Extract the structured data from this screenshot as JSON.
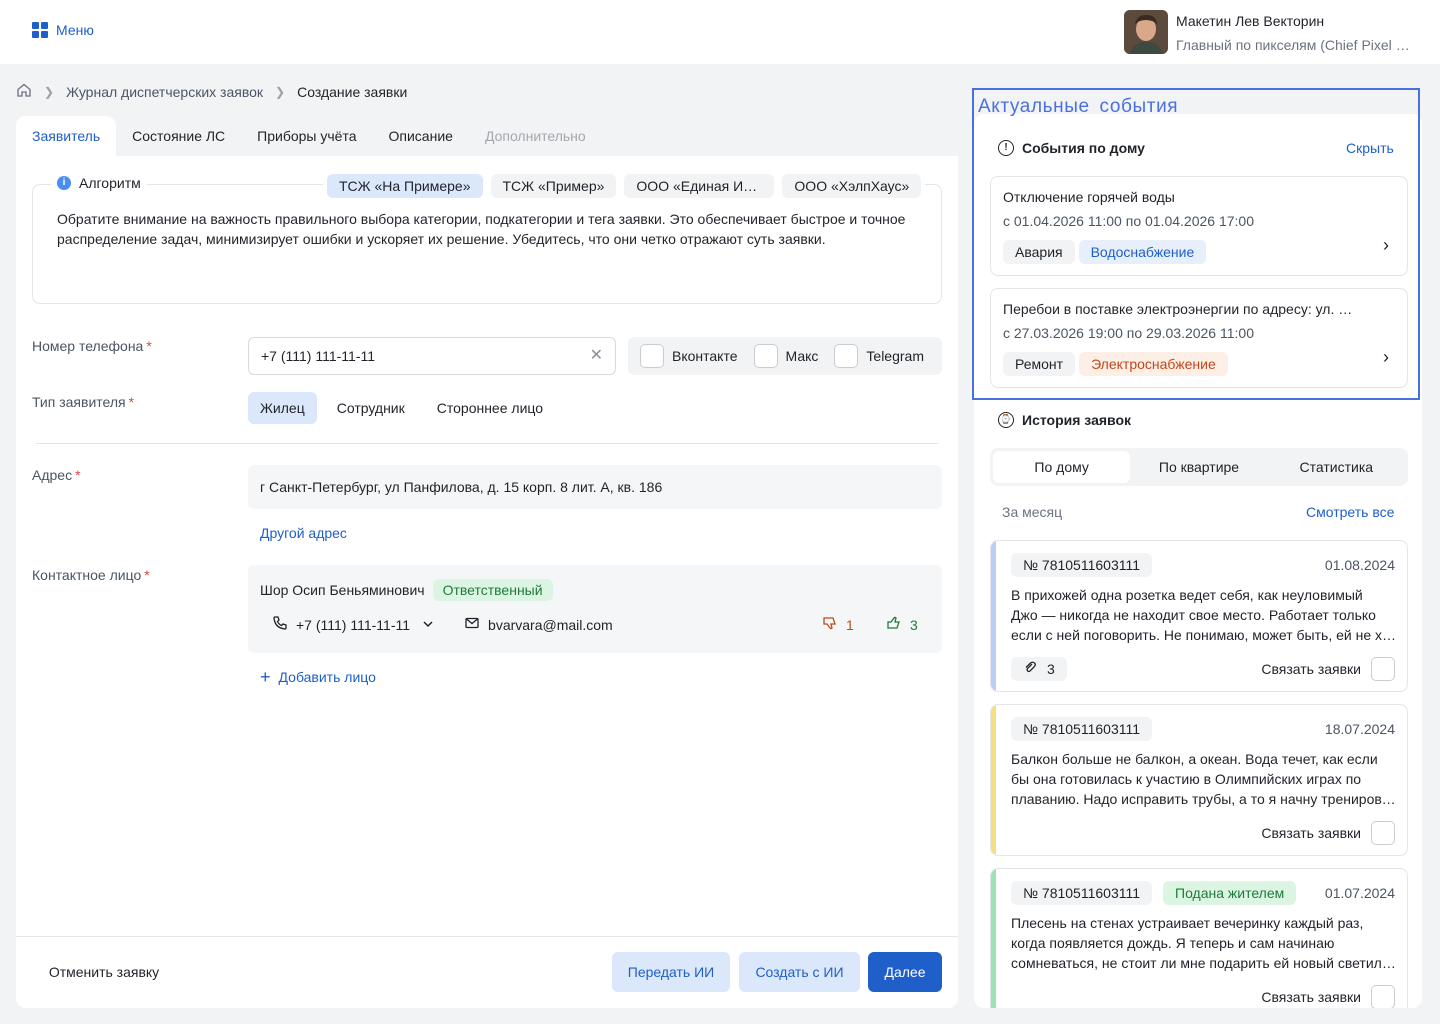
{
  "topbar": {
    "menu_label": "Меню",
    "user_name": "Макетин Лев Векторин",
    "user_role": "Главный по пикселям (Chief Pixel Officer)"
  },
  "breadcrumb": [
    "Журнал диспетчерских заявок",
    "Создание заявки"
  ],
  "tabs": [
    {
      "label": "Заявитель",
      "state": "active"
    },
    {
      "label": "Состояние ЛС",
      "state": "normal"
    },
    {
      "label": "Приборы учёта",
      "state": "normal"
    },
    {
      "label": "Описание",
      "state": "normal"
    },
    {
      "label": "Дополнительно",
      "state": "disabled"
    }
  ],
  "algorithm": {
    "title": "Алгоритм",
    "orgs": [
      "ТСЖ «На Примере»",
      "ТСЖ «Пример»",
      "ООО «Единая Информационная Служба»",
      "ООО «ХэлпХаус»"
    ],
    "selected_org": "ТСЖ «На Примере»",
    "text": "Обратите внимание на важность правильного выбора категории, подкатегории и тега заявки. Это обеспечивает быстрое и точное распределение задач, минимизирует ошибки и ускоряет их решение. Убедитесь, что они четко отражают суть заявки."
  },
  "form": {
    "phone_label": "Номер телефона",
    "phone_value": "+7 (111) 111-11-11",
    "messengers": [
      "Вконтакте",
      "Макс",
      "Telegram"
    ],
    "applicant_type_label": "Тип заявителя",
    "applicant_types": [
      "Жилец",
      "Сотрудник",
      "Стороннее лицо"
    ],
    "applicant_type_selected": "Жилец",
    "address_label": "Адрес",
    "address_value": "г Санкт-Петербург, ул Панфилова, д. 15 корп. 8 лит. А, кв. 186",
    "other_address": "Другой адрес",
    "contact_label": "Контактное лицо",
    "contact": {
      "name": "Шор Осип Беньяминович",
      "badge": "Ответственный",
      "phone": "+7 (111) 111-11-11",
      "email": "bvarvara@mail.com",
      "dislikes": "1",
      "likes": "3"
    },
    "add_contact": "Добавить лицо"
  },
  "footer": {
    "cancel": "Отменить заявку",
    "send_ai": "Передать ИИ",
    "create_ai": "Создать с ИИ",
    "next": "Далее"
  },
  "side": {
    "events_title": "Актуальные события",
    "house_events_title": "События по дому",
    "hide": "Скрыть",
    "events": [
      {
        "title": "Отключение горячей воды",
        "date": "с 01.04.2026 11:00 по 01.04.2026 17:00",
        "tags": [
          "Авария",
          "Водоснабжение"
        ]
      },
      {
        "title": "Перебои в поставке электроэнергии по адресу: ул. Панфилова",
        "date": "с 27.03.2026 19:00 по 29.03.2026 11:00",
        "tags": [
          "Ремонт",
          "Электроснабжение"
        ]
      }
    ],
    "history_title": "История заявок",
    "history_tabs": [
      "По дому",
      "По квартире",
      "Статистика"
    ],
    "history_tab_selected": "По дому",
    "period": "За месяц",
    "see_all": "Смотреть все",
    "link_label": "Связать заявки",
    "history": [
      {
        "number": "№ 7810511603111",
        "date": "01.08.2024",
        "stripe": "#b8cff5",
        "badge": "",
        "attachments": "3",
        "lines": [
          "В прихожей одна розетка ведет себя, как неуловимый",
          "Джо — никогда не находит свое место. Работает только",
          "если с ней поговорить. Не понимаю, может быть, ей не хватает внимания?"
        ]
      },
      {
        "number": "№ 7810511603111",
        "date": "18.07.2024",
        "stripe": "#f6de83",
        "badge": "",
        "attachments": "",
        "lines": [
          "Балкон больше не балкон, а океан. Вода течет, как если",
          "бы она готовилась к участию в Олимпийских играх по",
          "плаванию. Надо исправить трубы, а то я начну тренироваться."
        ]
      },
      {
        "number": "№ 7810511603111",
        "date": "01.07.2024",
        "stripe": "#9ee3b4",
        "badge": "Подана жителем",
        "attachments": "",
        "lines": [
          "Плесень на стенах устраивает вечеринку каждый раз,",
          "когда появляется дождь. Я теперь и сам начинаю",
          "сомневаться, не стоит ли мне подарить ей новый светильник."
        ]
      }
    ]
  }
}
